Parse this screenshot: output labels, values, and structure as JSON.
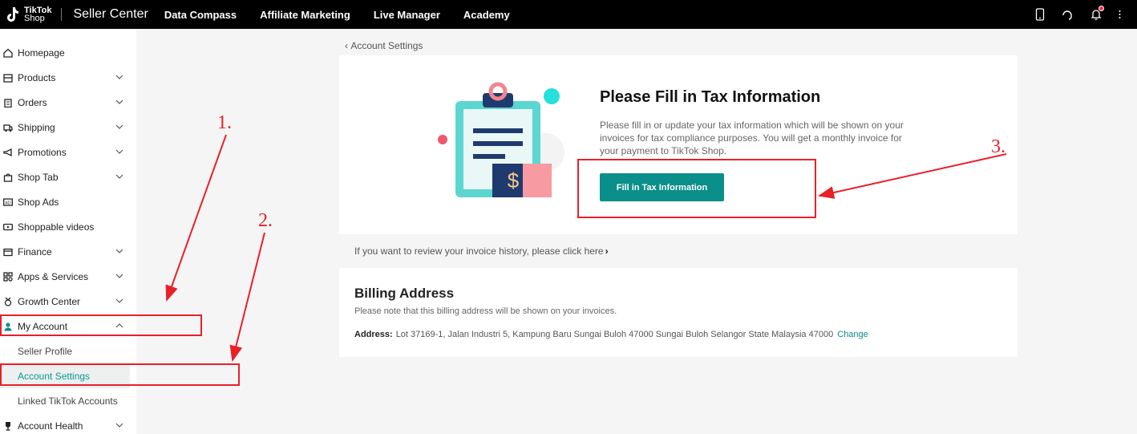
{
  "topbar": {
    "logo_line1": "TikTok",
    "logo_line2": "Shop",
    "brand": "Seller Center",
    "nav": [
      "Data Compass",
      "Affiliate Marketing",
      "Live Manager",
      "Academy"
    ]
  },
  "sidebar": {
    "items": [
      {
        "label": "Homepage",
        "icon": "home-icon",
        "expandable": false
      },
      {
        "label": "Products",
        "icon": "box-icon",
        "expandable": true
      },
      {
        "label": "Orders",
        "icon": "clipboard-icon",
        "expandable": true
      },
      {
        "label": "Shipping",
        "icon": "truck-icon",
        "expandable": true
      },
      {
        "label": "Promotions",
        "icon": "megaphone-icon",
        "expandable": true
      },
      {
        "label": "Shop Tab",
        "icon": "shop-bag-icon",
        "expandable": true
      },
      {
        "label": "Shop Ads",
        "icon": "ads-icon",
        "expandable": false
      },
      {
        "label": "Shoppable videos",
        "icon": "video-icon",
        "expandable": false
      },
      {
        "label": "Finance",
        "icon": "wallet-icon",
        "expandable": true
      },
      {
        "label": "Apps & Services",
        "icon": "apps-icon",
        "expandable": true
      },
      {
        "label": "Growth Center",
        "icon": "medal-icon",
        "expandable": true
      },
      {
        "label": "My Account",
        "icon": "user-icon",
        "expandable": true,
        "expanded": true
      },
      {
        "label": "Account Health",
        "icon": "trophy-icon",
        "expandable": true
      }
    ],
    "sub_items": [
      {
        "label": "Seller Profile",
        "active": false
      },
      {
        "label": "Account Settings",
        "active": true
      },
      {
        "label": "Linked TikTok Accounts",
        "active": false
      }
    ]
  },
  "main": {
    "breadcrumb": "Account Settings",
    "tax": {
      "title": "Please Fill in Tax Information",
      "description": "Please fill in or update your tax information which will be shown on your invoices for tax compliance purposes. You will get a monthly invoice for your payment to TikTok Shop.",
      "button": "Fill in Tax Information"
    },
    "invoice_link": "If you want to review your invoice history, please click here",
    "billing": {
      "title": "Billing Address",
      "note": "Please note that this billing address will be shown on your invoices.",
      "address_label": "Address:",
      "address": "Lot 37169-1, Jalan Industri 5, Kampung Baru Sungai Buloh 47000 Sungai Buloh Selangor State Malaysia 47000",
      "change": "Change"
    }
  },
  "annotations": [
    "1.",
    "2.",
    "3."
  ],
  "colors": {
    "accent": "#0a8f8a",
    "annotation": "#e8202a",
    "topbar": "#000000"
  }
}
